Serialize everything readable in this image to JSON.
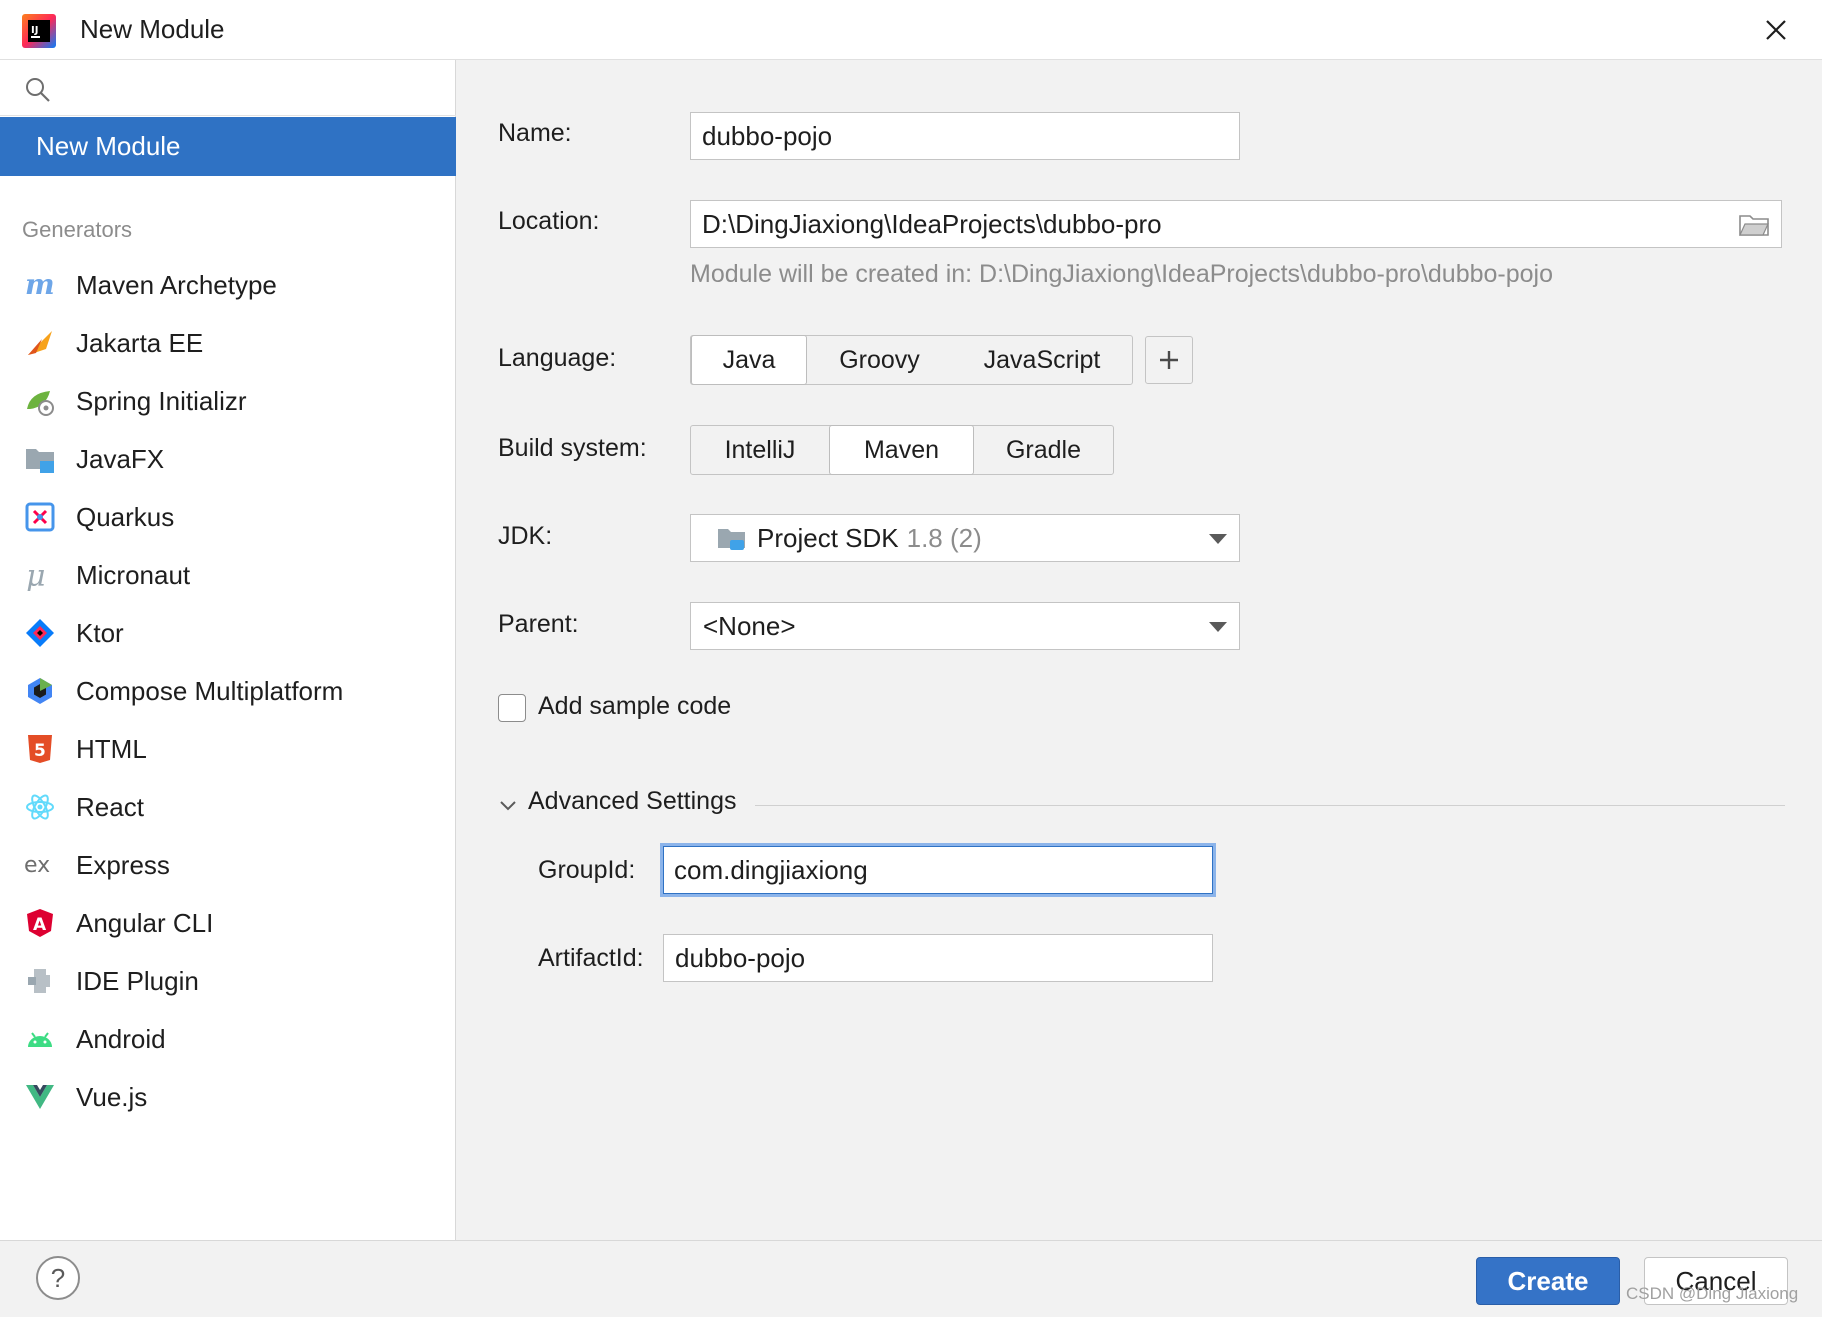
{
  "window": {
    "title": "New Module"
  },
  "sidebar": {
    "search_placeholder": "",
    "selected_label": "New Module",
    "generators_header": "Generators",
    "generators": [
      {
        "label": "Maven Archetype",
        "icon": "maven-icon"
      },
      {
        "label": "Jakarta EE",
        "icon": "jakarta-icon"
      },
      {
        "label": "Spring Initializr",
        "icon": "spring-icon"
      },
      {
        "label": "JavaFX",
        "icon": "javafx-icon"
      },
      {
        "label": "Quarkus",
        "icon": "quarkus-icon"
      },
      {
        "label": "Micronaut",
        "icon": "micronaut-icon"
      },
      {
        "label": "Ktor",
        "icon": "ktor-icon"
      },
      {
        "label": "Compose Multiplatform",
        "icon": "compose-icon"
      },
      {
        "label": "HTML",
        "icon": "html5-icon"
      },
      {
        "label": "React",
        "icon": "react-icon"
      },
      {
        "label": "Express",
        "icon": "express-icon"
      },
      {
        "label": "Angular CLI",
        "icon": "angular-icon"
      },
      {
        "label": "IDE Plugin",
        "icon": "plugin-icon"
      },
      {
        "label": "Android",
        "icon": "android-icon"
      },
      {
        "label": "Vue.js",
        "icon": "vue-icon"
      }
    ]
  },
  "form": {
    "name_label": "Name:",
    "name_value": "dubbo-pojo",
    "location_label": "Location:",
    "location_value": "D:\\DingJiaxiong\\IdeaProjects\\dubbo-pro",
    "location_hint": "Module will be created in: D:\\DingJiaxiong\\IdeaProjects\\dubbo-pro\\dubbo-pojo",
    "language_label": "Language:",
    "languages": [
      "Java",
      "Groovy",
      "JavaScript"
    ],
    "language_selected": "Java",
    "build_label": "Build system:",
    "builds": [
      "IntelliJ",
      "Maven",
      "Gradle"
    ],
    "build_selected": "Maven",
    "jdk_label": "JDK:",
    "jdk_name": "Project SDK",
    "jdk_version": "1.8 (2)",
    "parent_label": "Parent:",
    "parent_value": "<None>",
    "sample_code_label": "Add sample code",
    "sample_code_checked": false,
    "advanced_label": "Advanced Settings",
    "groupid_label": "GroupId:",
    "groupid_value": "com.dingjiaxiong",
    "artifactid_label": "ArtifactId:",
    "artifactid_value": "dubbo-pojo"
  },
  "footer": {
    "help_label": "?",
    "create_label": "Create",
    "cancel_label": "Cancel"
  },
  "watermark": "CSDN @Ding Jiaxiong",
  "colors": {
    "accent": "#2f72c4",
    "create_button": "#3573c7",
    "focus_ring": "#8cb4ea"
  }
}
